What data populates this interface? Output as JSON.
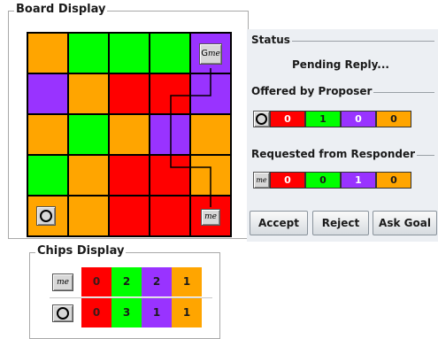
{
  "colors": {
    "orange": "#ffa500",
    "green": "#00ff00",
    "red": "#ff0000",
    "purple": "#9933ff",
    "panel_bg": "#eceff3"
  },
  "board": {
    "title": "Board Display",
    "cells": [
      [
        "orange",
        "green",
        "green",
        "green",
        "purple"
      ],
      [
        "purple",
        "orange",
        "red",
        "red",
        "purple"
      ],
      [
        "orange",
        "green",
        "orange",
        "purple",
        "orange"
      ],
      [
        "green",
        "orange",
        "red",
        "red",
        "orange"
      ],
      [
        "orange",
        "orange",
        "red",
        "red",
        "red"
      ]
    ],
    "goal_token": {
      "g": "G",
      "label": "me",
      "row": 0,
      "col": 4
    },
    "me_token": {
      "label": "me",
      "row": 4,
      "col": 4
    },
    "opponent_token": {
      "icon": "circle-icon",
      "row": 4,
      "col": 0
    }
  },
  "status": {
    "title": "Status",
    "text": "Pending Reply..."
  },
  "offered": {
    "title": "Offered by Proposer",
    "icon": "circle-icon",
    "chips": [
      {
        "color": "red",
        "value": "0"
      },
      {
        "color": "green",
        "value": "1"
      },
      {
        "color": "purple",
        "value": "0"
      },
      {
        "color": "orange",
        "value": "0"
      }
    ]
  },
  "requested": {
    "title": "Requested from Responder",
    "icon_label": "me",
    "chips": [
      {
        "color": "red",
        "value": "0"
      },
      {
        "color": "green",
        "value": "0"
      },
      {
        "color": "purple",
        "value": "1"
      },
      {
        "color": "orange",
        "value": "0"
      }
    ]
  },
  "buttons": {
    "accept": "Accept",
    "reject": "Reject",
    "ask_goal": "Ask Goal"
  },
  "chips_display": {
    "title": "Chips Display",
    "rows": [
      {
        "player": "me",
        "values": [
          "0",
          "2",
          "2",
          "1"
        ]
      },
      {
        "player": "circle",
        "values": [
          "0",
          "3",
          "1",
          "1"
        ]
      }
    ],
    "colors": [
      "red",
      "green",
      "purple",
      "orange"
    ]
  }
}
